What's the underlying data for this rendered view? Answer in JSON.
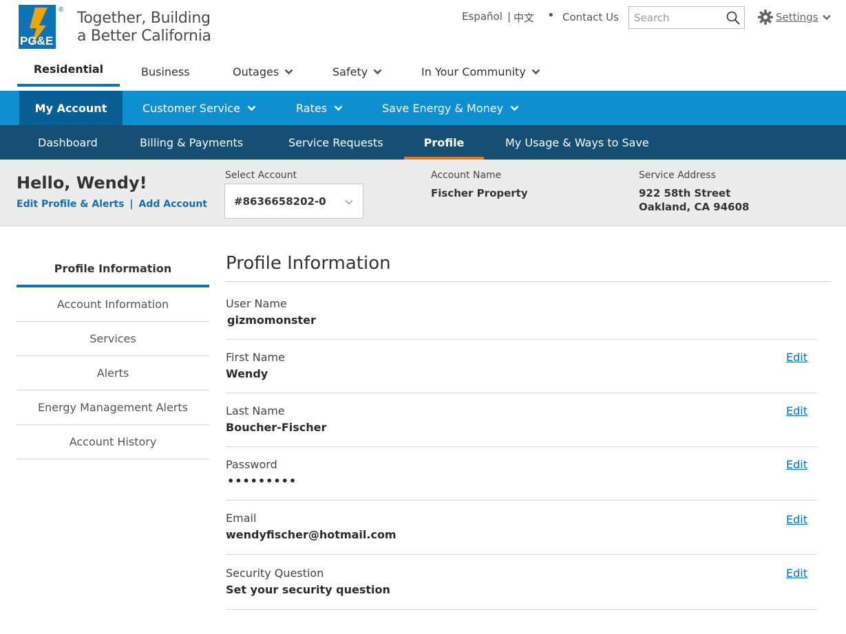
{
  "brand": {
    "logo_text": "PG&E",
    "registered_mark": "®",
    "tagline_line1": "Together, Building",
    "tagline_line2": "a Better California",
    "color_blue": "#0c73b4",
    "color_orange": "#f0a500"
  },
  "utility_nav": {
    "espanol": "Español",
    "separator": "|",
    "chinese": "中文",
    "dot": "•",
    "contact": "Contact Us",
    "search_placeholder": "Search",
    "search_value": "",
    "settings": "Settings"
  },
  "main_nav": {
    "items": [
      {
        "label": "Residential",
        "active": true
      },
      {
        "label": "Business"
      },
      {
        "label": "Outages",
        "dropdown": true
      },
      {
        "label": "Safety",
        "dropdown": true
      },
      {
        "label": "In Your Community",
        "dropdown": true
      }
    ]
  },
  "account_nav": {
    "items": [
      {
        "label": "My Account",
        "active": true
      },
      {
        "label": "Customer Service",
        "dropdown": true
      },
      {
        "label": "Rates",
        "dropdown": true
      },
      {
        "label": "Save Energy & Money",
        "dropdown": true
      }
    ],
    "color": "#0d8fd0",
    "active_color": "#075f95"
  },
  "sub_nav": {
    "items": [
      {
        "label": "Dashboard"
      },
      {
        "label": "Billing & Payments"
      },
      {
        "label": "Service Requests"
      },
      {
        "label": "Profile",
        "active": true
      },
      {
        "label": "My Usage & Ways to Save"
      }
    ],
    "color": "#154f73",
    "active_underline": "#e6781e"
  },
  "banner": {
    "greeting": "Hello, Wendy!",
    "edit_profile_link": "Edit Profile & Alerts",
    "link_separator": "|",
    "add_account_link": "Add Account",
    "select_account_label": "Select Account",
    "selected_account": "#8636658202-0",
    "account_name_label": "Account Name",
    "account_name": "Fischer Property",
    "service_address_label": "Service Address",
    "service_address_line1": "922 58th Street",
    "service_address_line2": "Oakland, CA 94608"
  },
  "side_nav": {
    "heading": "Profile Information",
    "items": [
      {
        "label": "Account Information"
      },
      {
        "label": "Services"
      },
      {
        "label": "Alerts"
      },
      {
        "label": "Energy Management Alerts"
      },
      {
        "label": "Account History"
      }
    ]
  },
  "profile": {
    "title": "Profile Information",
    "edit_label": "Edit",
    "fields": [
      {
        "label": "User Name",
        "value": "gizmomonster",
        "editable": false
      },
      {
        "label": "First Name",
        "value": "Wendy",
        "editable": true
      },
      {
        "label": "Last Name",
        "value": "Boucher-Fischer",
        "editable": true
      },
      {
        "label": "Password",
        "value": "•••••••••",
        "editable": true
      },
      {
        "label": "Email",
        "value": "wendyfischer@hotmail.com",
        "editable": true
      },
      {
        "label": "Security Question",
        "value": "Set your security question",
        "editable": true
      }
    ]
  }
}
